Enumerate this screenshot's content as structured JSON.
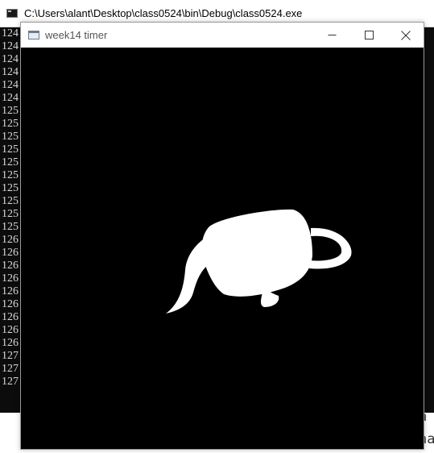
{
  "console": {
    "title": "C:\\Users\\alant\\Desktop\\class0524\\bin\\Debug\\class0524.exe",
    "lines": [
      "124",
      "124",
      "124",
      "124",
      "124",
      "124",
      "125",
      "125",
      "125",
      "125",
      "125",
      "125",
      "125",
      "125",
      "125",
      "125",
      "126",
      "126",
      "126",
      "126",
      "126",
      "126",
      "126",
      "126",
      "126",
      "127",
      "127",
      "127"
    ],
    "behind_text": [
      "a",
      "na"
    ]
  },
  "gl_window": {
    "title": "week14 timer",
    "buttons": {
      "minimize": "minimize-icon",
      "maximize": "maximize-icon",
      "close": "close-icon"
    }
  },
  "colors": {
    "console_bg": "#0c0c0c",
    "canvas_bg": "#000000",
    "teapot": "#ffffff"
  }
}
